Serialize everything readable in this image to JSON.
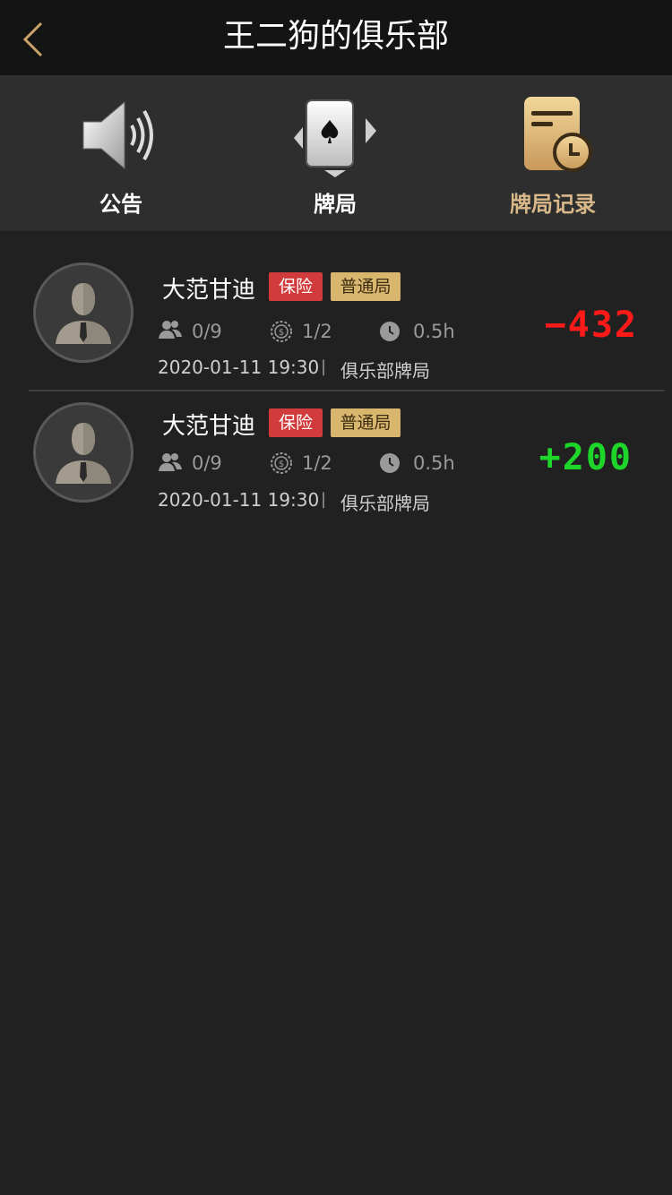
{
  "header": {
    "title": "王二狗的俱乐部"
  },
  "tabs": [
    {
      "label": "公告"
    },
    {
      "label": "牌局"
    },
    {
      "label": "牌局记录"
    }
  ],
  "colors": {
    "background": "#212121",
    "gold": "#d8b889",
    "negative": "#ff1a1a",
    "positive": "#1ed62a",
    "badge_insurance": "#d23b3b",
    "badge_type": "#d9b66e"
  },
  "records": [
    {
      "name": "大范甘迪",
      "badge_insurance": "保险",
      "badge_type": "普通局",
      "players": "0/9",
      "blinds": "1/2",
      "duration": "0.5h",
      "datetime": "2020-01-11 19:30",
      "separator": "|",
      "club": "俱乐部牌局",
      "score": "−432"
    },
    {
      "name": "大范甘迪",
      "badge_insurance": "保险",
      "badge_type": "普通局",
      "players": "0/9",
      "blinds": "1/2",
      "duration": "0.5h",
      "datetime": "2020-01-11 19:30",
      "separator": "|",
      "club": "俱乐部牌局",
      "score": "+200"
    }
  ]
}
